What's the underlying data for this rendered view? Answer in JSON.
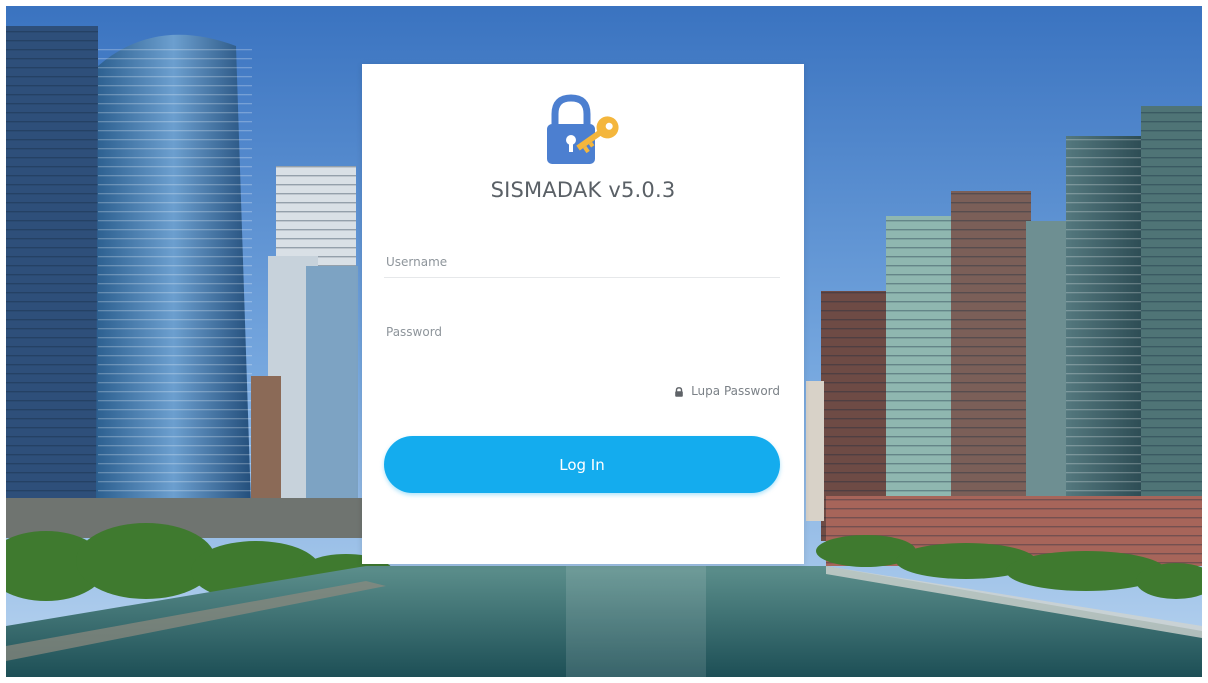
{
  "app": {
    "title": "SISMADAK v5.0.3"
  },
  "form": {
    "username_placeholder": "Username",
    "password_placeholder": "Password",
    "username_value": "",
    "password_value": "",
    "forgot_label": "Lupa Password",
    "login_label": "Log In"
  },
  "icons": {
    "logo": "padlock-key-icon",
    "forgot": "lock-icon"
  },
  "colors": {
    "accent": "#14acee",
    "logo_lock": "#4c7fd0",
    "logo_key": "#f4b63c"
  }
}
